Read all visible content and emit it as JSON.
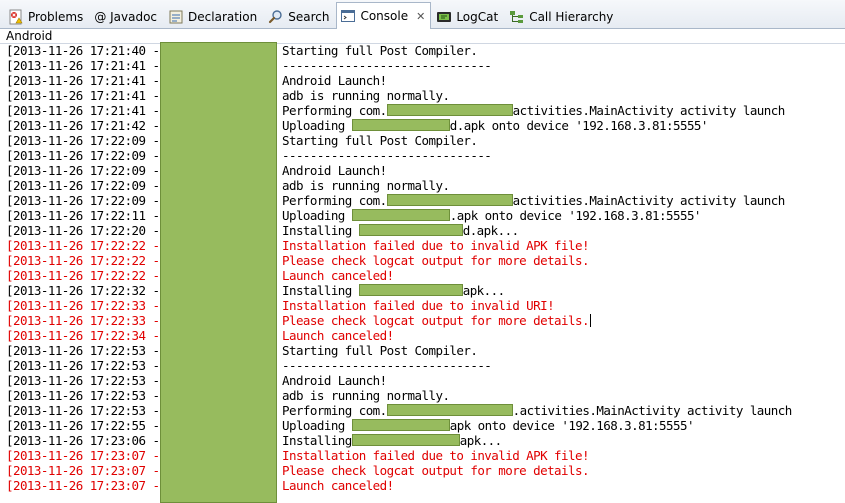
{
  "tabs": [
    {
      "label": "Problems",
      "icon": "problems-icon",
      "active": false
    },
    {
      "label": "@ Javadoc",
      "icon": "",
      "active": false
    },
    {
      "label": "Declaration",
      "icon": "declaration-icon",
      "active": false
    },
    {
      "label": "Search",
      "icon": "search-icon",
      "active": false
    },
    {
      "label": "Console",
      "icon": "console-icon",
      "active": true,
      "close": "✕"
    },
    {
      "label": "LogCat",
      "icon": "logcat-icon",
      "active": false
    },
    {
      "label": "Call Hierarchy",
      "icon": "call-hierarchy-icon",
      "active": false
    }
  ],
  "console_name": "Android",
  "lines": [
    {
      "ts": "[2013-11-26 17:21:40 -",
      "parts": [
        "Starting full Post Compiler."
      ],
      "err": false
    },
    {
      "ts": "[2013-11-26 17:21:41 -",
      "parts": [
        "------------------------------"
      ],
      "err": false
    },
    {
      "ts": "[2013-11-26 17:21:41 -",
      "parts": [
        "Android Launch!"
      ],
      "err": false
    },
    {
      "ts": "[2013-11-26 17:21:41 -",
      "parts": [
        "adb is running normally."
      ],
      "err": false
    },
    {
      "ts": "[2013-11-26 17:21:41 -",
      "parts": [
        "Performing com.",
        "activities.MainActivity activity launch"
      ],
      "err": false
    },
    {
      "ts": "[2013-11-26 17:21:42 -",
      "parts": [
        "Uploading ",
        "d.apk onto device '192.168.3.81:5555'"
      ],
      "err": false
    },
    {
      "ts": "[2013-11-26 17:22:09 -",
      "parts": [
        "Starting full Post Compiler."
      ],
      "err": false
    },
    {
      "ts": "[2013-11-26 17:22:09 -",
      "parts": [
        "------------------------------"
      ],
      "err": false
    },
    {
      "ts": "[2013-11-26 17:22:09 -",
      "parts": [
        "Android Launch!"
      ],
      "err": false
    },
    {
      "ts": "[2013-11-26 17:22:09 -",
      "parts": [
        "adb is running normally."
      ],
      "err": false
    },
    {
      "ts": "[2013-11-26 17:22:09 -",
      "parts": [
        "Performing com.",
        "activities.MainActivity activity launch"
      ],
      "err": false
    },
    {
      "ts": "[2013-11-26 17:22:11 -",
      "parts": [
        "Uploading ",
        ".apk onto device '192.168.3.81:5555'"
      ],
      "err": false
    },
    {
      "ts": "[2013-11-26 17:22:20 -",
      "parts": [
        "Installing ",
        "d.apk..."
      ],
      "err": false
    },
    {
      "ts": "[2013-11-26 17:22:22 -",
      "parts": [
        "Installation failed due to invalid APK file!"
      ],
      "err": true
    },
    {
      "ts": "[2013-11-26 17:22:22 -",
      "parts": [
        "Please check logcat output for more details."
      ],
      "err": true
    },
    {
      "ts": "[2013-11-26 17:22:22 -",
      "parts": [
        "Launch canceled!"
      ],
      "err": true
    },
    {
      "ts": "[2013-11-26 17:22:32 -",
      "parts": [
        "Installing ",
        "apk..."
      ],
      "err": false
    },
    {
      "ts": "[2013-11-26 17:22:33 -",
      "parts": [
        "Installation failed due to invalid URI!"
      ],
      "err": true
    },
    {
      "ts": "[2013-11-26 17:22:33 -",
      "parts": [
        "Please check logcat output for more details."
      ],
      "err": true,
      "caret": true
    },
    {
      "ts": "[2013-11-26 17:22:34 -",
      "parts": [
        "Launch canceled!"
      ],
      "err": true
    },
    {
      "ts": "[2013-11-26 17:22:53 -",
      "parts": [
        "Starting full Post Compiler."
      ],
      "err": false
    },
    {
      "ts": "[2013-11-26 17:22:53 -",
      "parts": [
        "------------------------------"
      ],
      "err": false
    },
    {
      "ts": "[2013-11-26 17:22:53 -",
      "parts": [
        "Android Launch!"
      ],
      "err": false
    },
    {
      "ts": "[2013-11-26 17:22:53 -",
      "parts": [
        "adb is running normally."
      ],
      "err": false
    },
    {
      "ts": "[2013-11-26 17:22:53 -",
      "parts": [
        "Performing com.",
        ".activities.MainActivity activity launch"
      ],
      "err": false
    },
    {
      "ts": "[2013-11-26 17:22:55 -",
      "parts": [
        "Uploading ",
        "apk onto device '192.168.3.81:5555'"
      ],
      "err": false
    },
    {
      "ts": "[2013-11-26 17:23:06 -",
      "parts": [
        "Installing",
        "apk..."
      ],
      "err": false
    },
    {
      "ts": "[2013-11-26 17:23:07 -",
      "parts": [
        "Installation failed due to invalid APK file!"
      ],
      "err": true
    },
    {
      "ts": "[2013-11-26 17:23:07 -",
      "parts": [
        "Please check logcat output for more details."
      ],
      "err": true
    },
    {
      "ts": "[2013-11-26 17:23:07 -",
      "parts": [
        "Launch canceled!"
      ],
      "err": true
    }
  ],
  "colors": {
    "error": "#e00000",
    "output": "#000000",
    "redaction": "#97bb5e"
  }
}
